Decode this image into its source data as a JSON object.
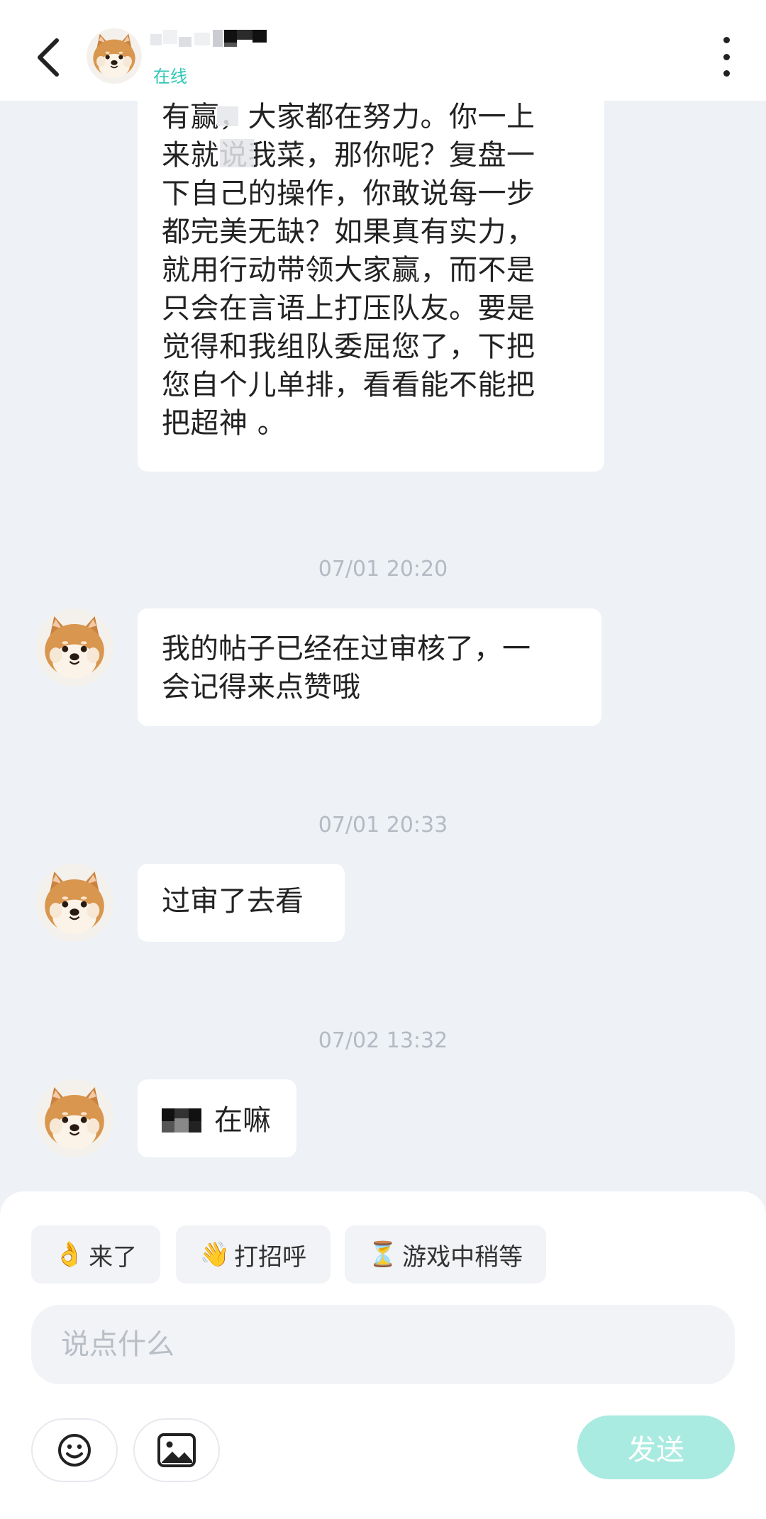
{
  "header": {
    "contact_status": "在线",
    "back_icon": "chevron-left-icon",
    "more_icon": "more-vertical-icon"
  },
  "messages": [
    {
      "lines": [
        "有赢，大家都在努力。你一上",
        "来就说我菜，那你呢？复盘一",
        "下自己的操作，你敢说每一步",
        "都完美无缺？如果真有实力，",
        "就用行动带领大家赢，而不是",
        "只会在言语上打压队友。要是",
        "觉得和我组队委屈您了，下把",
        "您自个儿单排，看看能不能把",
        "把超神 。"
      ]
    },
    {
      "timestamp": "07/01 20:20",
      "lines": [
        "我的帖子已经在过审核了，一",
        "会记得来点赞哦"
      ]
    },
    {
      "timestamp": "07/01 20:33",
      "text": "过审了去看"
    },
    {
      "timestamp": "07/02 13:32",
      "text": "在嘛"
    }
  ],
  "quick_replies": [
    {
      "emoji": "👌",
      "label": "来了"
    },
    {
      "emoji": "👋",
      "label": "打招呼"
    },
    {
      "emoji": "⏳",
      "label": "游戏中稍等"
    }
  ],
  "composer": {
    "placeholder": "说点什么",
    "send_label": "发送",
    "emoji_icon": "smiley-icon",
    "image_icon": "image-icon"
  },
  "colors": {
    "status": "#2fc7b4",
    "send_button": "#a9ebe1",
    "background": "#eef1f5"
  }
}
